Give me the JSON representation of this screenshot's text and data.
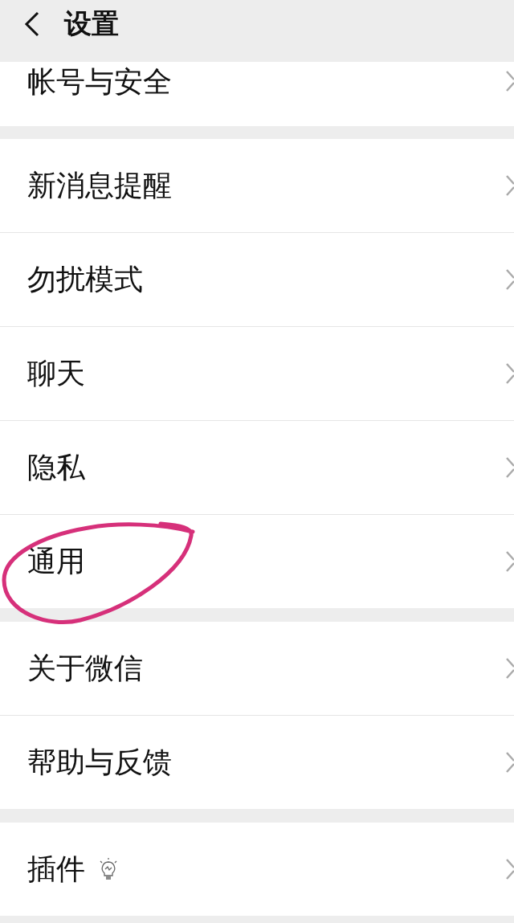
{
  "header": {
    "title": "设置"
  },
  "groups": [
    {
      "items": [
        {
          "label": "帐号与安全"
        }
      ]
    },
    {
      "items": [
        {
          "label": "新消息提醒"
        },
        {
          "label": "勿扰模式"
        },
        {
          "label": "聊天"
        },
        {
          "label": "隐私"
        },
        {
          "label": "通用",
          "circled": true
        }
      ]
    },
    {
      "items": [
        {
          "label": "关于微信"
        },
        {
          "label": "帮助与反馈"
        }
      ]
    },
    {
      "items": [
        {
          "label": "插件",
          "has_icon": true
        }
      ]
    }
  ]
}
